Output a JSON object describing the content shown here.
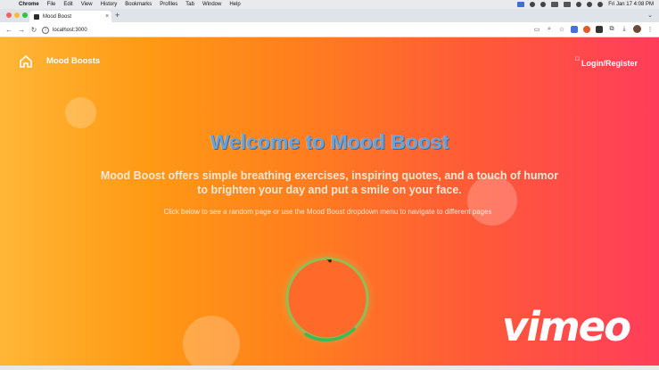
{
  "menubar": {
    "app": "Chrome",
    "items": [
      "File",
      "Edit",
      "View",
      "History",
      "Bookmarks",
      "Profiles",
      "Tab",
      "Window",
      "Help"
    ],
    "clock": "Fri Jan 17  4:08 PM"
  },
  "browser": {
    "tab_title": "Mood Boost",
    "new_tab": "+",
    "url": "localhost:3000"
  },
  "page": {
    "brand": "Mood Boosts",
    "login": "Login/Register",
    "headline": "Welcome to Mood Boost",
    "lead_line1": "Mood Boost offers simple breathing exercises, inspiring quotes, and a touch of humor",
    "lead_line2": "to brighten your day and put a smile on your face.",
    "hint": "Click below to see a random page or use the Mood Boost dropdown menu to navigate to different pages",
    "watermark": "vimeo"
  },
  "colors": {
    "headline": "#6aa3d8",
    "ring": "#ff6a2a",
    "ring_progress": "#3dba57"
  },
  "icons": {
    "home": "home-icon",
    "play": "play-icon"
  }
}
